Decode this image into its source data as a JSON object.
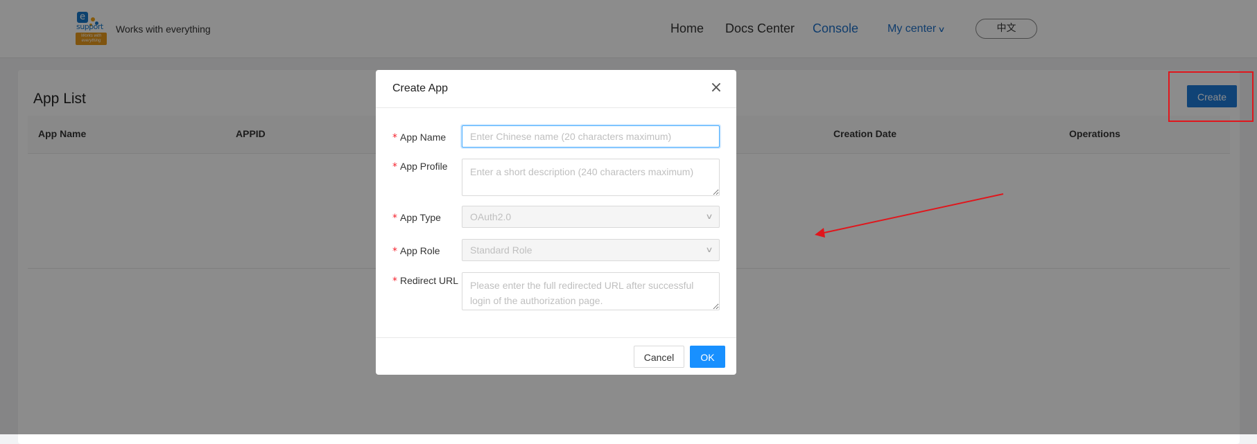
{
  "header": {
    "logo": {
      "mark": "e",
      "word": "support",
      "plate": "Works with everything"
    },
    "tagline": "Works with everything",
    "nav": {
      "home": "Home",
      "docs": "Docs Center",
      "console": "Console",
      "my_center": "My center",
      "language": "中文"
    }
  },
  "page": {
    "title": "App List",
    "create_label": "Create",
    "table": {
      "columns": [
        "App Name",
        "APPID",
        "",
        "",
        "Creation Date",
        "Operations"
      ],
      "rows": []
    }
  },
  "modal": {
    "title": "Create App",
    "close_glyph": "×",
    "fields": {
      "app_name": {
        "label": "App Name",
        "value": "",
        "placeholder": "Enter Chinese name (20 characters maximum)"
      },
      "app_profile": {
        "label": "App Profile",
        "value": "",
        "placeholder": "Enter a short description (240 characters maximum)"
      },
      "app_type": {
        "label": "App Type",
        "value": "OAuth2.0"
      },
      "app_role": {
        "label": "App Role",
        "value": "Standard Role"
      },
      "redirect_url": {
        "label": "Redirect URL",
        "value": "",
        "placeholder": "Please enter the full redirected URL after successful login of the authorization page."
      }
    },
    "cancel_label": "Cancel",
    "ok_label": "OK"
  },
  "colors": {
    "primary": "#1890ff",
    "nav_active": "#1e6fc6",
    "annotation_red": "#e0161c",
    "required_star": "#f5222d"
  }
}
